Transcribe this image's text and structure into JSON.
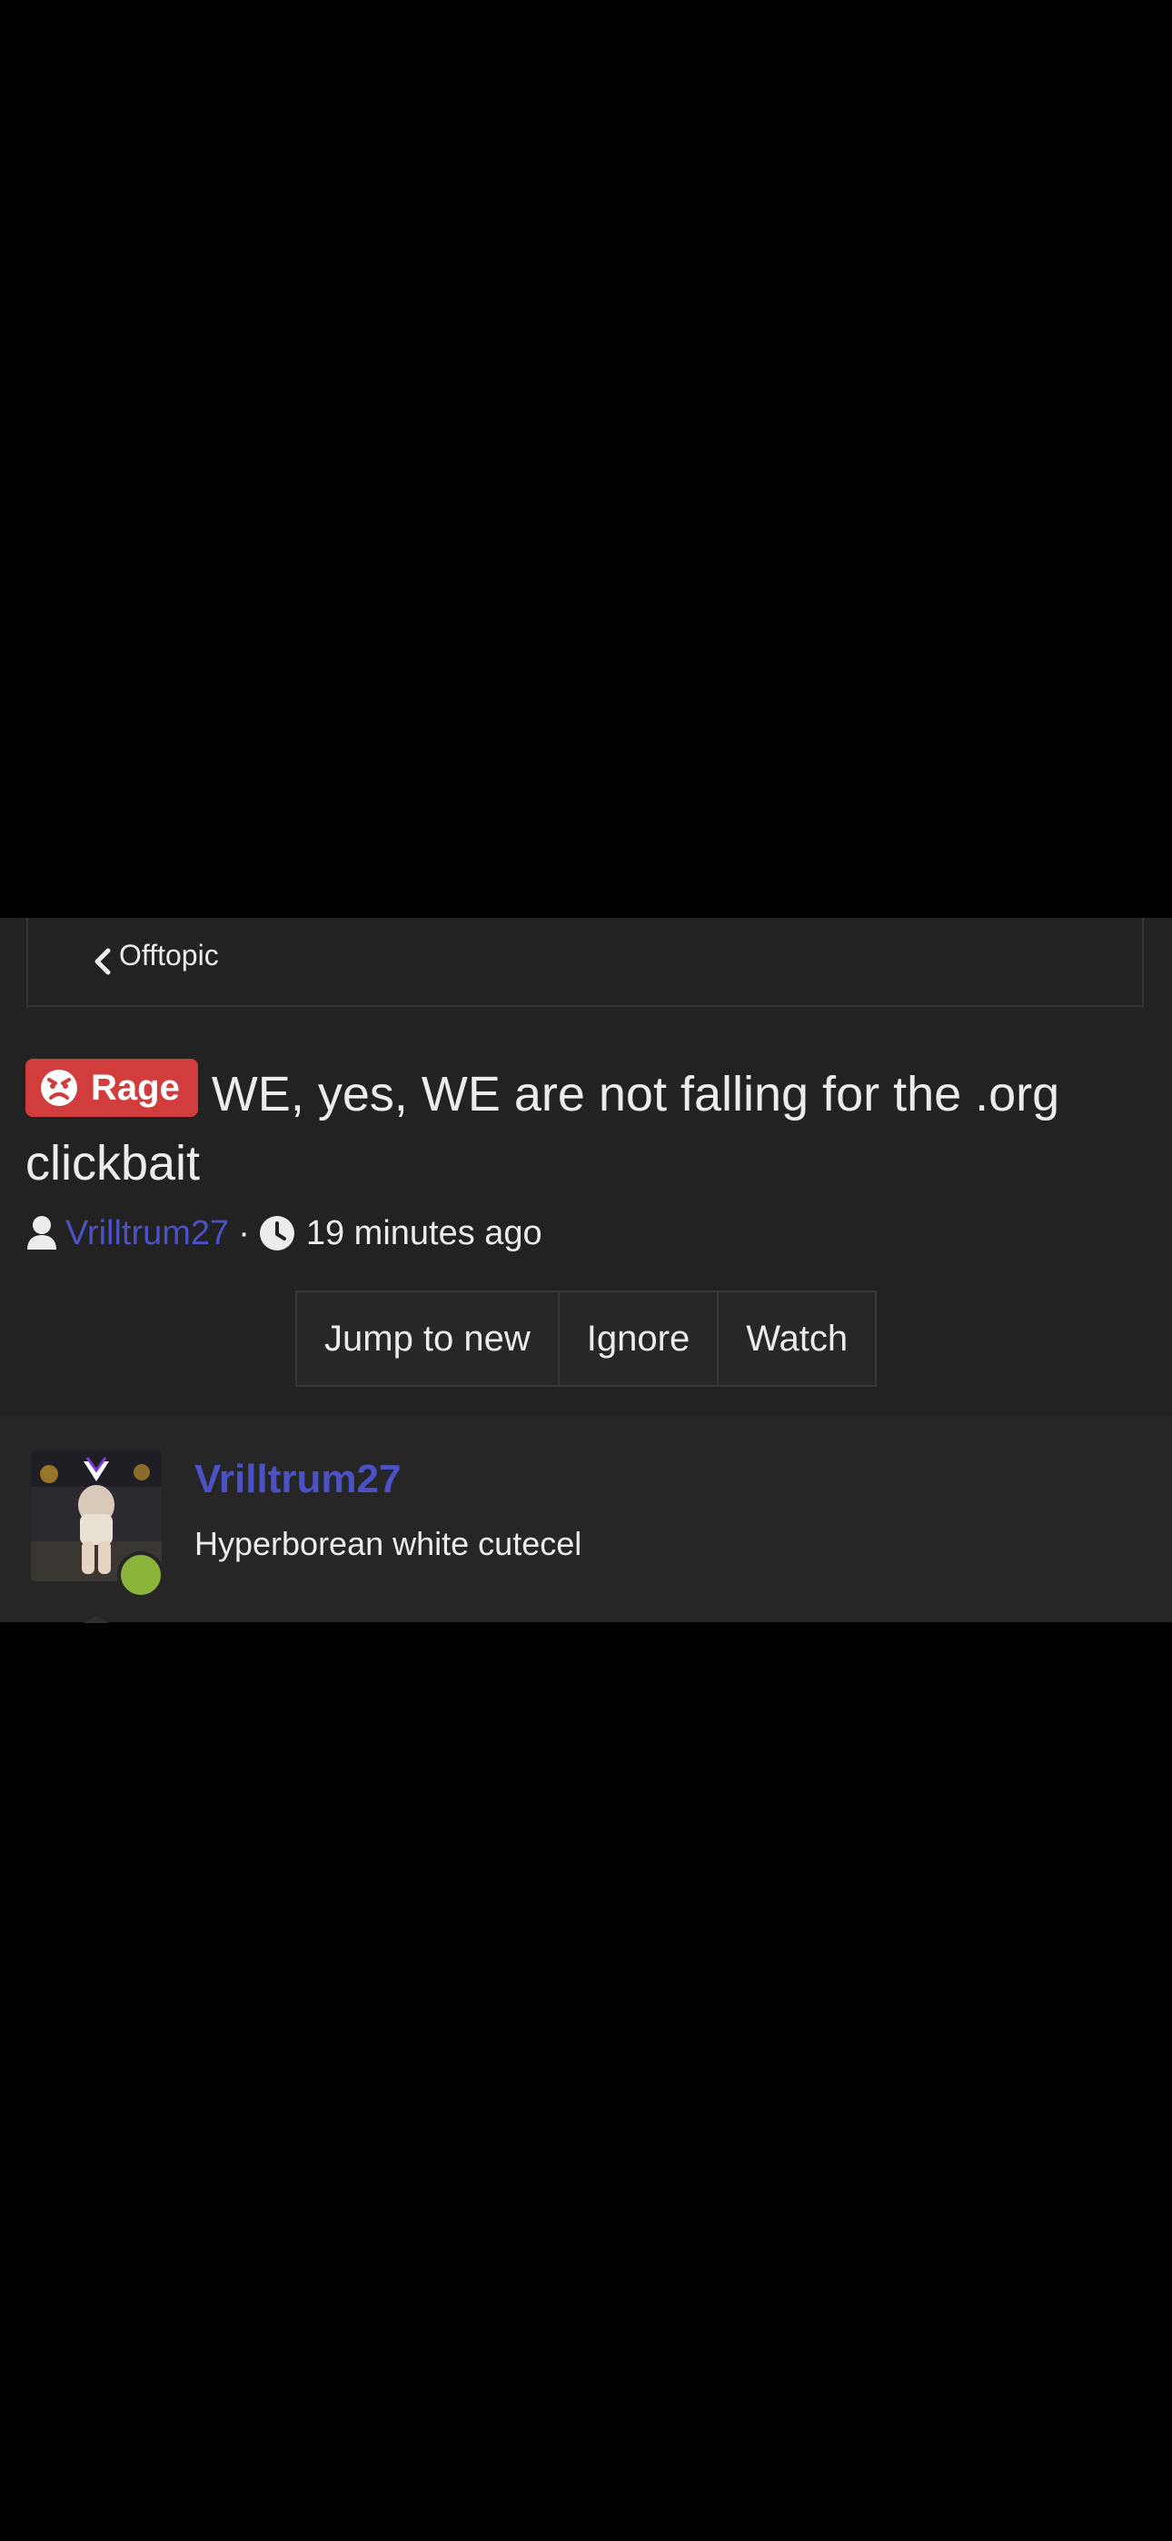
{
  "breadcrumb": {
    "label": "Offtopic"
  },
  "thread": {
    "prefix": "Rage",
    "title": "WE, yes, WE are not falling for the .org clickbait",
    "author": "Vrilltrum27",
    "separator": "·",
    "time": "19 minutes ago"
  },
  "actions": {
    "jump": "Jump to new",
    "ignore": "Ignore",
    "watch": "Watch"
  },
  "post": {
    "username": "Vrilltrum27",
    "user_title": "Hyperborean white cutecel",
    "online": true
  },
  "colors": {
    "background": "#000000",
    "panel": "#222222",
    "accent_link": "#4a52c6",
    "rage_badge": "#d13d3d",
    "online": "#8ab53a"
  },
  "icons": {
    "back": "chevron-left-icon",
    "prefix": "angry-face-icon",
    "author": "user-icon",
    "time": "clock-icon"
  }
}
